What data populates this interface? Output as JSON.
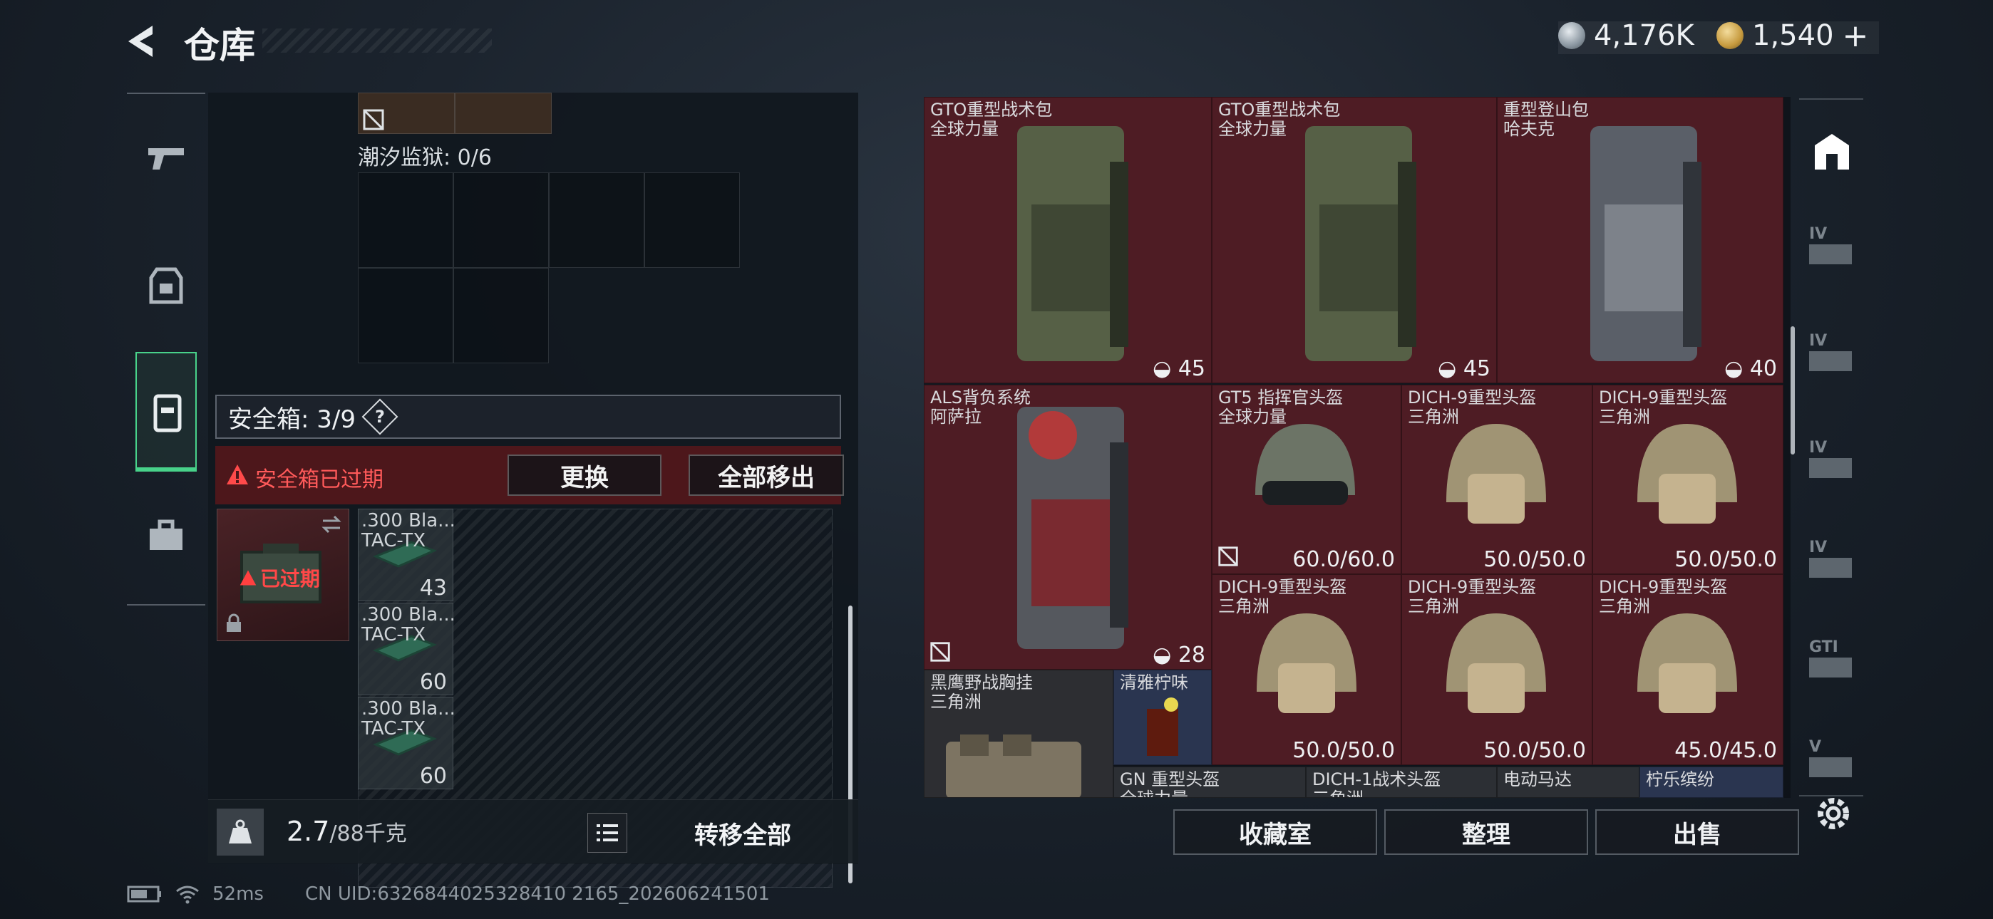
{
  "header": {
    "title": "仓库",
    "currency_1": "4,176K",
    "currency_2": "1,540",
    "add_symbol": "+"
  },
  "left_nav": {
    "items": [
      {
        "icon": "pistol-icon"
      },
      {
        "icon": "gear-vest-icon"
      },
      {
        "icon": "backpack-icon",
        "active": true
      },
      {
        "icon": "briefcase-icon"
      }
    ]
  },
  "container": {
    "prison_label": "潮汐监狱: 0/6"
  },
  "safebox": {
    "label": "安全箱: 3/9",
    "help": "?",
    "expired_warning": "安全箱已过期",
    "replace_button": "更换",
    "remove_all_button": "全部移出",
    "expired_badge": "已过期",
    "ammo": [
      {
        "name": ".300 Bla...\nTAC-TX",
        "count": "43"
      },
      {
        "name": ".300 Bla...\nTAC-TX",
        "count": "60"
      },
      {
        "name": ".300 Bla...\nTAC-TX",
        "count": "60"
      }
    ]
  },
  "footer_left": {
    "weight_value": "2.7",
    "weight_cap": "/88千克",
    "transfer_all": "转移全部"
  },
  "status_bar": {
    "ping": "52ms",
    "uid": "CN UID:6326844025328410 2165_202606241501"
  },
  "storage_items": [
    {
      "name": "GTO重型战术包",
      "sub": "全球力量",
      "value": "45",
      "kind": "backpack"
    },
    {
      "name": "GTO重型战术包",
      "sub": "全球力量",
      "value": "45",
      "kind": "backpack"
    },
    {
      "name": "重型登山包",
      "sub": "哈夫克",
      "value": "40",
      "kind": "backpack"
    },
    {
      "name": "ALS背负系统",
      "sub": "阿萨拉",
      "value": "28",
      "kind": "backpack"
    },
    {
      "name": "GT5 指挥官头盔",
      "sub": "全球力量",
      "value": "60.0/60.0",
      "kind": "helmet"
    },
    {
      "name": "DICH-9重型头盔",
      "sub": "三角洲",
      "value": "50.0/50.0",
      "kind": "helmet"
    },
    {
      "name": "DICH-9重型头盔",
      "sub": "三角洲",
      "value": "50.0/50.0",
      "kind": "helmet"
    },
    {
      "name": "DICH-9重型头盔",
      "sub": "三角洲",
      "value": "50.0/50.0",
      "kind": "helmet"
    },
    {
      "name": "DICH-9重型头盔",
      "sub": "三角洲",
      "value": "50.0/50.0",
      "kind": "helmet"
    },
    {
      "name": "DICH-9重型头盔",
      "sub": "三角洲",
      "value": "45.0/45.0",
      "kind": "helmet"
    },
    {
      "name": "黑鹰野战胸挂",
      "sub": "三角洲",
      "value": "",
      "kind": "rig"
    },
    {
      "name": "清雅柠味",
      "sub": "",
      "value": "",
      "kind": "drink"
    },
    {
      "name": "GN 重型头盔",
      "sub": "全球力量",
      "value": "",
      "kind": "helmet"
    },
    {
      "name": "DICH-1战术头盔",
      "sub": "三角洲",
      "value": "",
      "kind": "helmet"
    },
    {
      "name": "电动马达",
      "sub": "",
      "value": "",
      "kind": "part"
    },
    {
      "name": "柠乐缤纷",
      "sub": "",
      "value": "",
      "kind": "drink"
    }
  ],
  "bottom_actions": {
    "collection": "收藏室",
    "organize": "整理",
    "sell": "出售"
  },
  "right_nav": {
    "items": [
      "IV",
      "IV",
      "IV",
      "IV",
      "GTI",
      "V"
    ]
  }
}
